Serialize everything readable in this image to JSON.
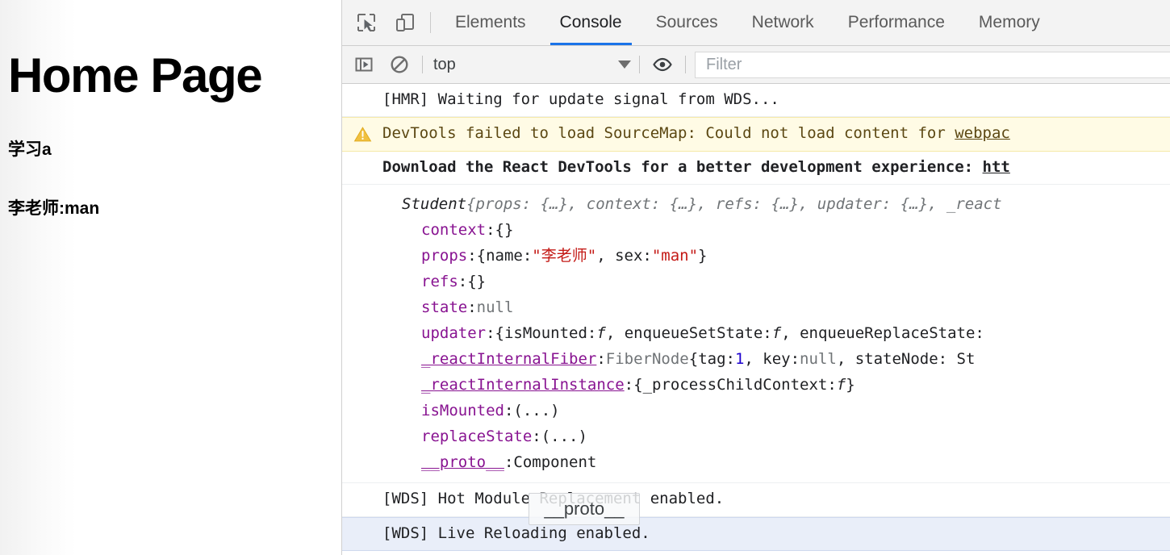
{
  "page": {
    "title": "Home Page",
    "lines": [
      "学习a",
      "李老师:man"
    ]
  },
  "devtools": {
    "toolbar_icons": [
      {
        "name": "inspect-element-icon"
      },
      {
        "name": "device-toolbar-icon"
      }
    ],
    "tabs": [
      {
        "label": "Elements",
        "active": false
      },
      {
        "label": "Console",
        "active": true
      },
      {
        "label": "Sources",
        "active": false
      },
      {
        "label": "Network",
        "active": false
      },
      {
        "label": "Performance",
        "active": false
      },
      {
        "label": "Memory",
        "active": false
      }
    ],
    "active_tab": "Console",
    "accent_color": "#1a73e8",
    "console_toolbar": {
      "sidebar_toggle_icon": "console-sidebar-icon",
      "clear_icon": "clear-console-icon",
      "context_selected": "top",
      "context_options": [
        "top"
      ],
      "eye_icon": "create-live-expression-icon",
      "filter_placeholder": "Filter",
      "filter_value": ""
    },
    "messages": [
      {
        "id": "hmr-waiting",
        "level": "log",
        "text": "[HMR] Waiting for update signal from WDS..."
      },
      {
        "id": "sourcemap-warning",
        "level": "warning",
        "icon": "warning-triangle-icon",
        "text": "DevTools failed to load SourceMap: Could not load content for ",
        "link": "webpac"
      },
      {
        "id": "react-devtools",
        "level": "info",
        "text": "Download the React DevTools for a better development experience: ",
        "link": "htt"
      }
    ],
    "object_log": {
      "class_name": "Student",
      "preview": " {props: {…}, context: {…}, refs: {…}, updater: {…}, _react",
      "expanded": true,
      "properties": [
        {
          "key": "context",
          "arrow": "right",
          "value_parts": [
            {
              "t": "punc",
              "v": ": "
            },
            {
              "t": "plain",
              "v": "{}"
            }
          ]
        },
        {
          "key": "props",
          "arrow": "right",
          "value_parts": [
            {
              "t": "punc",
              "v": ": "
            },
            {
              "t": "plain",
              "v": "{name: "
            },
            {
              "t": "str",
              "v": "\"李老师\""
            },
            {
              "t": "plain",
              "v": ", sex: "
            },
            {
              "t": "str",
              "v": "\"man\""
            },
            {
              "t": "plain",
              "v": "}"
            }
          ]
        },
        {
          "key": "refs",
          "arrow": "right",
          "value_parts": [
            {
              "t": "punc",
              "v": ": "
            },
            {
              "t": "plain",
              "v": "{}"
            }
          ]
        },
        {
          "key": "state",
          "arrow": "none",
          "value_parts": [
            {
              "t": "punc",
              "v": ": "
            },
            {
              "t": "nullv",
              "v": "null"
            }
          ]
        },
        {
          "key": "updater",
          "arrow": "right",
          "value_parts": [
            {
              "t": "punc",
              "v": ": "
            },
            {
              "t": "plain",
              "v": "{isMounted: "
            },
            {
              "t": "fn",
              "v": "f"
            },
            {
              "t": "plain",
              "v": ", enqueueSetState: "
            },
            {
              "t": "fn",
              "v": "f"
            },
            {
              "t": "plain",
              "v": ", enqueueReplaceState: "
            }
          ]
        },
        {
          "key": "_reactInternalFiber",
          "underline": true,
          "arrow": "right",
          "value_parts": [
            {
              "t": "punc",
              "v": ": "
            },
            {
              "t": "dim",
              "v": "FiberNode "
            },
            {
              "t": "plain",
              "v": "{tag: "
            },
            {
              "t": "num",
              "v": "1"
            },
            {
              "t": "plain",
              "v": ", key: "
            },
            {
              "t": "nullv",
              "v": "null"
            },
            {
              "t": "plain",
              "v": ", stateNode: St"
            }
          ]
        },
        {
          "key": "_reactInternalInstance",
          "underline": true,
          "arrow": "right",
          "value_parts": [
            {
              "t": "punc",
              "v": ": "
            },
            {
              "t": "plain",
              "v": "{_processChildContext: "
            },
            {
              "t": "fn",
              "v": "f"
            },
            {
              "t": "plain",
              "v": "}"
            }
          ]
        },
        {
          "key": "isMounted",
          "arrow": "none",
          "value_parts": [
            {
              "t": "punc",
              "v": ": "
            },
            {
              "t": "plain",
              "v": "(...)"
            }
          ]
        },
        {
          "key": "replaceState",
          "arrow": "none",
          "value_parts": [
            {
              "t": "punc",
              "v": ": "
            },
            {
              "t": "plain",
              "v": "(...)"
            }
          ]
        },
        {
          "key": "__proto__",
          "underline": true,
          "arrow": "right",
          "value_parts": [
            {
              "t": "punc",
              "v": ": "
            },
            {
              "t": "plain",
              "v": "Component"
            }
          ]
        }
      ]
    },
    "messages_after": [
      {
        "id": "wds-hmr",
        "level": "log",
        "text": "[WDS] Hot Module Replacement enabled.",
        "selected": false
      },
      {
        "id": "wds-live-reload",
        "level": "log",
        "text": "[WDS] Live Reloading enabled.",
        "selected": true
      }
    ],
    "tooltip": {
      "text": "__proto__"
    }
  }
}
